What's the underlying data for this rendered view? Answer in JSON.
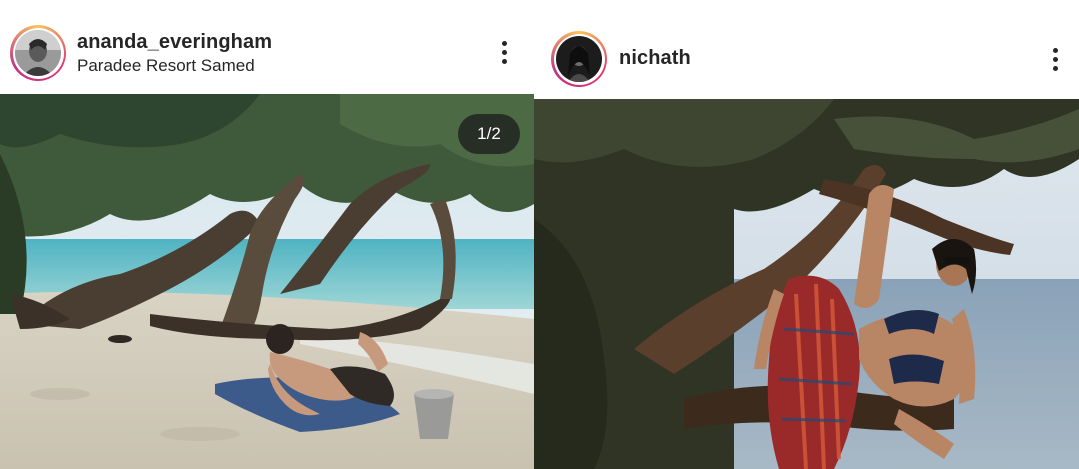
{
  "posts": [
    {
      "username": "ananda_everingham",
      "location": "Paradee Resort Samed",
      "carousel_counter": "1/2",
      "menu_icon": "more-vertical-icon"
    },
    {
      "username": "nichath",
      "menu_icon": "more-vertical-icon"
    }
  ],
  "colors": {
    "text": "#262626",
    "story_ring_start": "#f9c45c",
    "story_ring_end": "#c13584",
    "counter_bg": "#1e1e1e"
  }
}
